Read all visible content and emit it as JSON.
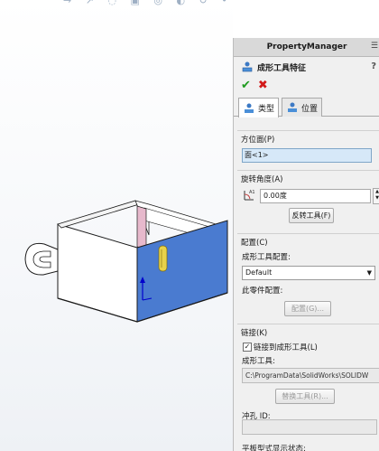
{
  "heads_up_toolbar": {
    "glyphs": "→ ↗ ◌ ▣ ◎ ◐ ↺ • ▦ ≡ ↕"
  },
  "property_manager": {
    "title": "PropertyManager",
    "feature_title": "成形工具特征",
    "ok_icon": "✔",
    "cancel_icon": "✖",
    "tabs": [
      {
        "label": "类型"
      },
      {
        "label": "位置"
      }
    ],
    "orientation_face": {
      "title": "方位面(P)",
      "value": "面<1>"
    },
    "rotation": {
      "title": "旋转角度(A)",
      "value": "0.00度",
      "flip_button": "反转工具(F)"
    },
    "configuration": {
      "title": "配置(C)",
      "tool_config_label": "成形工具配置:",
      "tool_config_value": "Default",
      "instance_config_label": "此零件配置:",
      "config_button": "配置(G)..."
    },
    "link": {
      "title": "链接(K)",
      "checkbox_label": "链接到成形工具(L)",
      "checked": true,
      "tool_label": "成形工具:",
      "tool_path": "C:\\ProgramData\\SolidWorks\\SOLIDW",
      "replace_button": "替换工具(R)...",
      "punch_label": "冲孔 ID:",
      "punch_value": "",
      "partial_label": "平板型式显示状态:"
    }
  },
  "colors": {
    "part_face": "#4a7bd0",
    "part_edge": "#1a1a1a",
    "highlight": "#e8d24a",
    "pink_face": "#e7b9cc"
  }
}
